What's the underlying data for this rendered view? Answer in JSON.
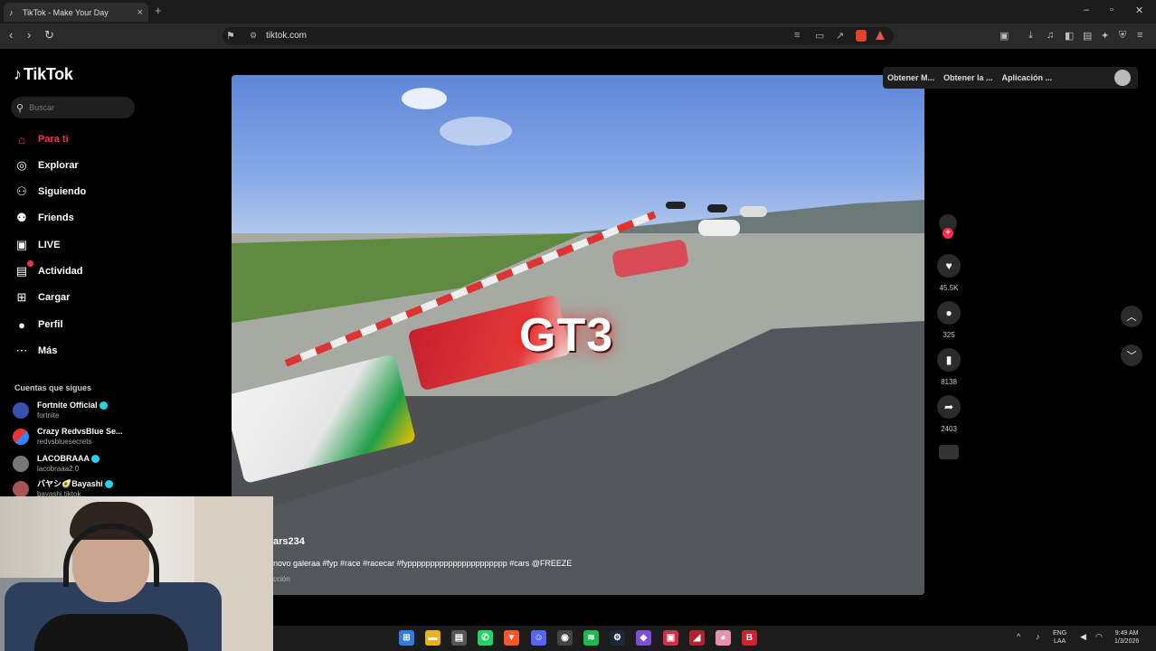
{
  "browser": {
    "tab_title": "TikTok - Make Your Day",
    "url": "tiktok.com",
    "accent_color": "#fe2c55"
  },
  "sidebar": {
    "brand": "TikTok",
    "search_placeholder": "Buscar",
    "nav": [
      {
        "label": "Para ti",
        "icon": "home-icon",
        "active": true
      },
      {
        "label": "Explorar",
        "icon": "compass-icon"
      },
      {
        "label": "Siguiendo",
        "icon": "following-icon"
      },
      {
        "label": "Friends",
        "icon": "friends-icon"
      },
      {
        "label": "LIVE",
        "icon": "live-icon"
      },
      {
        "label": "Actividad",
        "icon": "activity-icon"
      },
      {
        "label": "Cargar",
        "icon": "upload-icon"
      },
      {
        "label": "Perfil",
        "icon": "profile-icon"
      },
      {
        "label": "Más",
        "icon": "more-icon"
      }
    ],
    "following_title": "Cuentas que sigues",
    "accounts": [
      {
        "name": "Fortnite Official",
        "handle": "fortnite",
        "verified": true
      },
      {
        "name": "Crazy RedvsBlue Se...",
        "handle": "redvsbluesecrets",
        "verified": false
      },
      {
        "name": "LACOBRAAA",
        "handle": "lacobraaa2.0",
        "verified": true
      },
      {
        "name": "バヤシ🥑Bayashi",
        "handle": "bayashi.tiktok",
        "verified": true
      }
    ]
  },
  "video": {
    "overlay_text": "GT3",
    "username": "ars234",
    "description": "novo galeraa #fyp #race #racecar #fypppppppppppppppppppppp #cars @FREEZE",
    "more": "cción"
  },
  "rail": {
    "likes": "45.5K",
    "comments": "325",
    "saves": "8138",
    "shares": "2403"
  },
  "topbar": {
    "item1": "Obtener M...",
    "item2": "Obtener la ...",
    "item3": "Aplicación ..."
  },
  "taskbar": {
    "lang1": "ENG",
    "lang2": "LAA",
    "time": "9:49 AM",
    "date": "1/3/2026"
  }
}
